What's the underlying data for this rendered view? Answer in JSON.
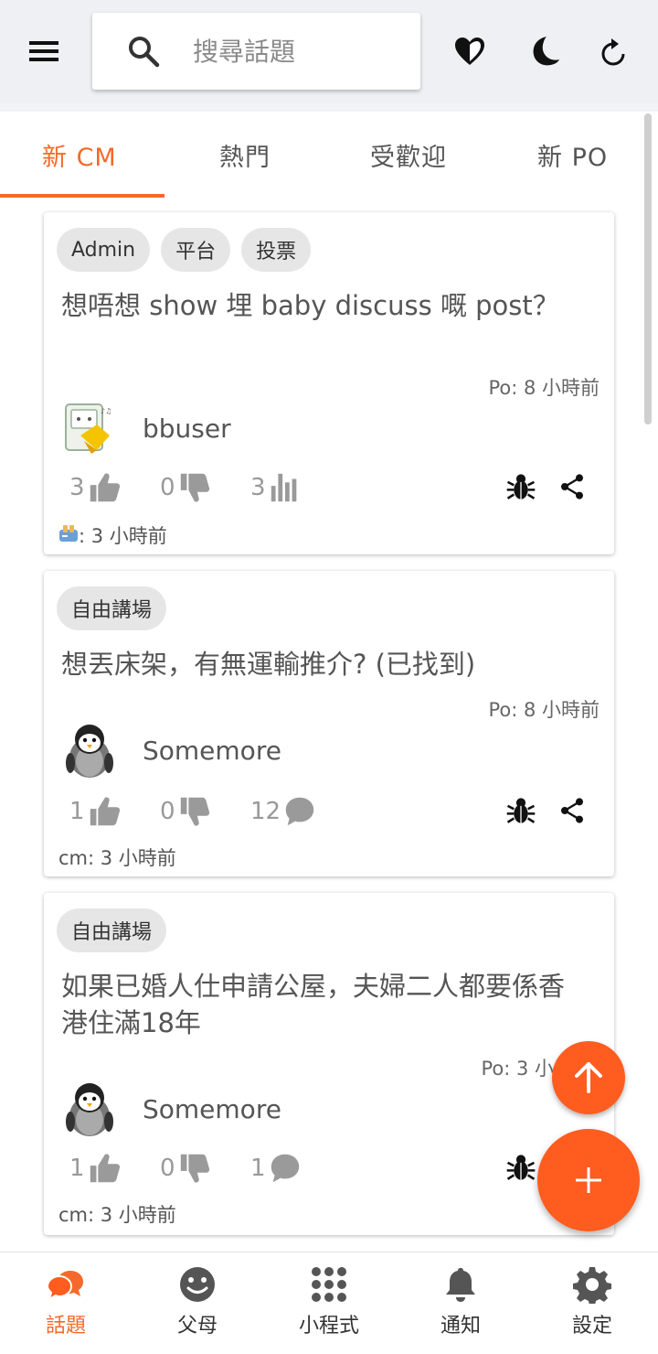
{
  "header": {
    "search_placeholder": "搜尋話題"
  },
  "tabs": [
    {
      "label": "新 CM",
      "active": true
    },
    {
      "label": "熱門",
      "active": false
    },
    {
      "label": "受歡迎",
      "active": false
    },
    {
      "label": "新 PO",
      "active": false
    }
  ],
  "posts": [
    {
      "tags": [
        "Admin",
        "平台",
        "投票"
      ],
      "title": "想唔想 show 埋 baby discuss 嘅 post？",
      "po_time": "Po: 8 小時前",
      "username": "bbuser",
      "likes": "3",
      "dislikes": "0",
      "third_count": "3",
      "third_icon": "bar-chart-icon",
      "footer": ": 3 小時前",
      "footer_icon": "toaster-emoji-icon"
    },
    {
      "tags": [
        "自由講場"
      ],
      "title": "想丟床架，有無運輸推介? (已找到)",
      "po_time": "Po: 8 小時前",
      "username": "Somemore",
      "likes": "1",
      "dislikes": "0",
      "third_count": "12",
      "third_icon": "comment-icon",
      "footer": "cm: 3 小時前"
    },
    {
      "tags": [
        "自由講場"
      ],
      "title": "如果已婚人仕申請公屋，夫婦二人都要係香港住滿18年",
      "po_time": "Po: 3 小",
      "username": "Somemore",
      "likes": "1",
      "dislikes": "0",
      "third_count": "1",
      "third_icon": "comment-icon",
      "footer": "cm: 3 小時前"
    }
  ],
  "bottom_nav": [
    {
      "label": "話題",
      "icon": "chat-bubbles-icon",
      "active": true
    },
    {
      "label": "父母",
      "icon": "smiley-icon",
      "active": false
    },
    {
      "label": "小程式",
      "icon": "apps-grid-icon",
      "active": false
    },
    {
      "label": "通知",
      "icon": "bell-icon",
      "active": false
    },
    {
      "label": "設定",
      "icon": "gear-icon",
      "active": false
    }
  ],
  "colors": {
    "accent": "#f26a2a",
    "fab": "#ff5c1f",
    "tag_bg": "#e6e6e6",
    "topbar_bg": "#eef0f3"
  }
}
